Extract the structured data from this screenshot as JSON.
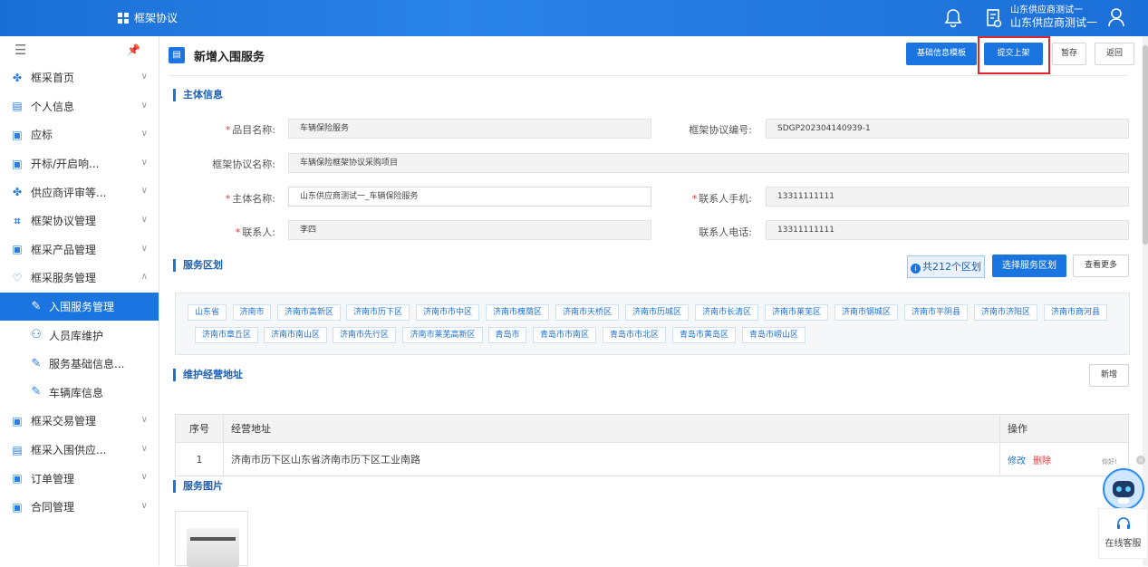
{
  "topbar": {
    "system_name": "框架协议",
    "user_line1": "山东供应商测试一",
    "user_line2": "山东供应商测试一"
  },
  "sidebar": {
    "items": [
      {
        "label": "框采首页",
        "icon": "home-clover-icon"
      },
      {
        "label": "个人信息",
        "icon": "id-card-icon"
      },
      {
        "label": "应标",
        "icon": "doc-search-icon"
      },
      {
        "label": "开标/开启响...",
        "icon": "doc-search-icon"
      },
      {
        "label": "供应商评审等...",
        "icon": "clover-icon"
      },
      {
        "label": "框架协议管理",
        "icon": "frame-icon"
      },
      {
        "label": "框采产品管理",
        "icon": "doc-search-icon"
      },
      {
        "label": "框采服务管理",
        "icon": "heart-hand-icon"
      }
    ],
    "sub_items": [
      {
        "label": "入围服务管理"
      },
      {
        "label": "人员库维护"
      },
      {
        "label": "服务基础信息..."
      },
      {
        "label": "车辆库信息"
      }
    ],
    "items_after": [
      {
        "label": "框采交易管理"
      },
      {
        "label": "框采入围供应..."
      },
      {
        "label": "订单管理"
      },
      {
        "label": "合同管理"
      }
    ]
  },
  "page": {
    "title": "新增入围服务",
    "buttons": {
      "template": "基础信息模板",
      "submit": "提交上架",
      "draft": "暂存",
      "back": "返回"
    }
  },
  "main_info": {
    "section_title": "主体信息",
    "fields": {
      "item_name_label": "品目名称:",
      "item_name_value": "车辆保险服务",
      "agreement_no_label": "框架协议编号:",
      "agreement_no_value": "SDGP202304140939-1",
      "agreement_name_label": "框架协议名称:",
      "agreement_name_value": "车辆保险框架协议采购项目",
      "subject_name_label": "主体名称:",
      "subject_name_value": "山东供应商测试一_车辆保险服务",
      "mobile_label": "联系人手机:",
      "mobile_value": "13311111111",
      "contact_label": "联系人:",
      "contact_value": "李四",
      "phone_label": "联系人电话:",
      "phone_value": "13311111111"
    }
  },
  "region": {
    "section_title": "服务区划",
    "count_text": "共212个区划",
    "select_button": "选择服务区划",
    "more_button": "查看更多",
    "chips_row1": [
      "山东省",
      "济南市",
      "济南市高新区",
      "济南市历下区",
      "济南市市中区",
      "济南市槐荫区",
      "济南市天桥区",
      "济南市历城区",
      "济南市长清区",
      "济南市莱芜区",
      "济南市钢城区",
      "济南市平阴县",
      "济南市济阳区",
      "济南市商河县"
    ],
    "chips_row2": [
      "济南市章丘区",
      "济南市南山区",
      "济南市先行区",
      "济南市莱芜高新区",
      "青岛市",
      "青岛市市南区",
      "青岛市市北区",
      "青岛市黄岛区",
      "青岛市崂山区"
    ]
  },
  "address": {
    "section_title": "维护经营地址",
    "add_button": "新增",
    "table": {
      "headers": [
        "序号",
        "经营地址",
        "操作"
      ],
      "rows": [
        {
          "index": "1",
          "address": "济南市历下区山东省济南市历下区工业南路",
          "edit": "修改",
          "delete": "删除"
        }
      ]
    }
  },
  "images": {
    "section_title": "服务图片"
  },
  "widget": {
    "hint": "你好!",
    "service_label": "在线客服"
  }
}
